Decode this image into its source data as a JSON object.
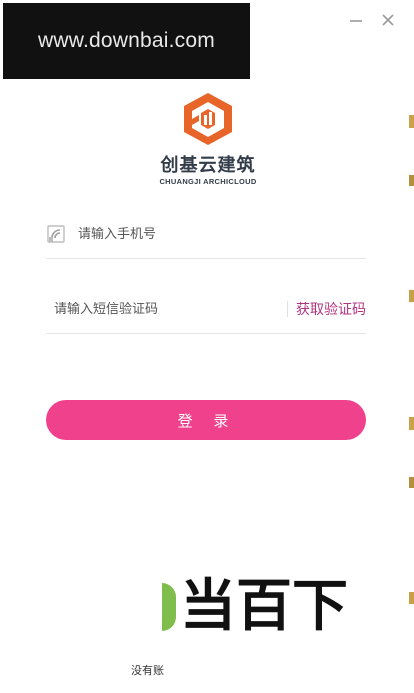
{
  "watermark": {
    "text": "www.downbai.com"
  },
  "window_controls": {
    "minimize_icon": "minimize-icon",
    "close_icon": "close-icon"
  },
  "logo": {
    "name": "创基云建筑",
    "subtitle": "CHUANGJI ARCHICLOUD",
    "colors": {
      "mark": "#e8652a",
      "text": "#333d4a"
    }
  },
  "form": {
    "phone_placeholder": "请输入手机号",
    "phone_icon": "phone-icon",
    "code_placeholder": "请输入短信验证码",
    "get_code_label": "获取验证码",
    "login_label": "登 录"
  },
  "footer": {
    "register_text": "没有账",
    "brand_watermark": "当百下"
  },
  "colors": {
    "accent": "#f0428c",
    "link": "#b1347f"
  }
}
